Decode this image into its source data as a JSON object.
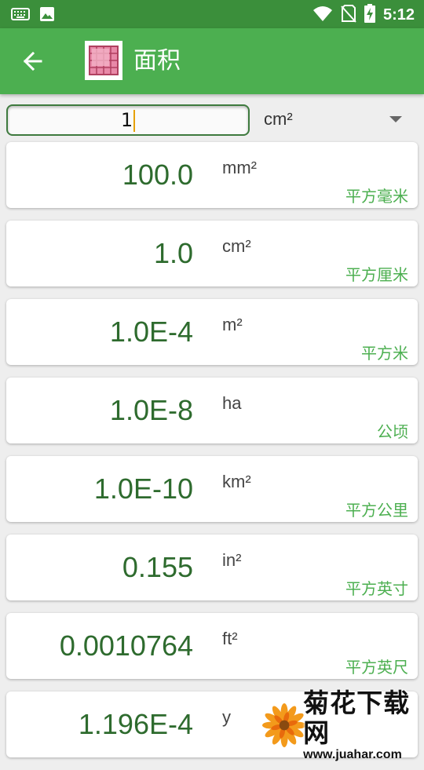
{
  "status_bar": {
    "time": "5:12",
    "left_icons": [
      "keyboard-icon",
      "image-icon"
    ],
    "right_icons": [
      "wifi-icon",
      "no-sim-icon",
      "battery-charging-icon"
    ]
  },
  "app_bar": {
    "title": "面积",
    "back_icon": "arrow-left-icon",
    "app_icon": "area-grid-icon",
    "color": "#4caf50"
  },
  "input": {
    "value": "1",
    "unit": "cm²"
  },
  "results": [
    {
      "value": "100.0",
      "unit": "mm²",
      "name": "平方毫米"
    },
    {
      "value": "1.0",
      "unit": "cm²",
      "name": "平方厘米"
    },
    {
      "value": "1.0E-4",
      "unit": "m²",
      "name": "平方米"
    },
    {
      "value": "1.0E-8",
      "unit": "ha",
      "name": "公顷"
    },
    {
      "value": "1.0E-10",
      "unit": "km²",
      "name": "平方公里"
    },
    {
      "value": "0.155",
      "unit": "in²",
      "name": "平方英寸"
    },
    {
      "value": "0.0010764",
      "unit": "ft²",
      "name": "平方英尺"
    },
    {
      "value": "1.196E-4",
      "unit": "y",
      "name": ""
    }
  ],
  "watermark": {
    "title": "菊花下载网",
    "url": "www.juahar.com"
  }
}
